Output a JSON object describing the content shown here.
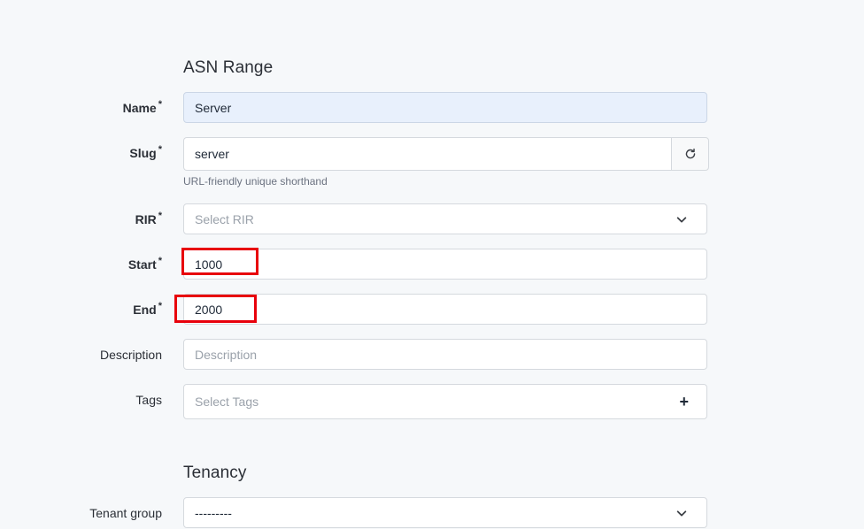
{
  "sections": {
    "asn_range_title": "ASN Range",
    "tenancy_title": "Tenancy"
  },
  "fields": {
    "name": {
      "label": "Name",
      "required_mark": "*",
      "value": "Server"
    },
    "slug": {
      "label": "Slug",
      "required_mark": "*",
      "value": "server",
      "help": "URL-friendly unique shorthand"
    },
    "rir": {
      "label": "RIR",
      "required_mark": "*",
      "placeholder": "Select RIR"
    },
    "start": {
      "label": "Start",
      "required_mark": "*",
      "value": "1000"
    },
    "end": {
      "label": "End",
      "required_mark": "*",
      "value": "2000"
    },
    "description": {
      "label": "Description",
      "placeholder": "Description"
    },
    "tags": {
      "label": "Tags",
      "placeholder": "Select Tags",
      "add_symbol": "+"
    },
    "tenant_group": {
      "label": "Tenant group",
      "value": "---------"
    }
  },
  "icons": {
    "regenerate": "refresh-icon",
    "dropdown": "chevron-down-icon",
    "add": "plus-icon"
  },
  "colors": {
    "page_background": "#f6f8fa",
    "autofilled_input": "#e8f0fc",
    "annotation_highlight": "#e8000b"
  }
}
